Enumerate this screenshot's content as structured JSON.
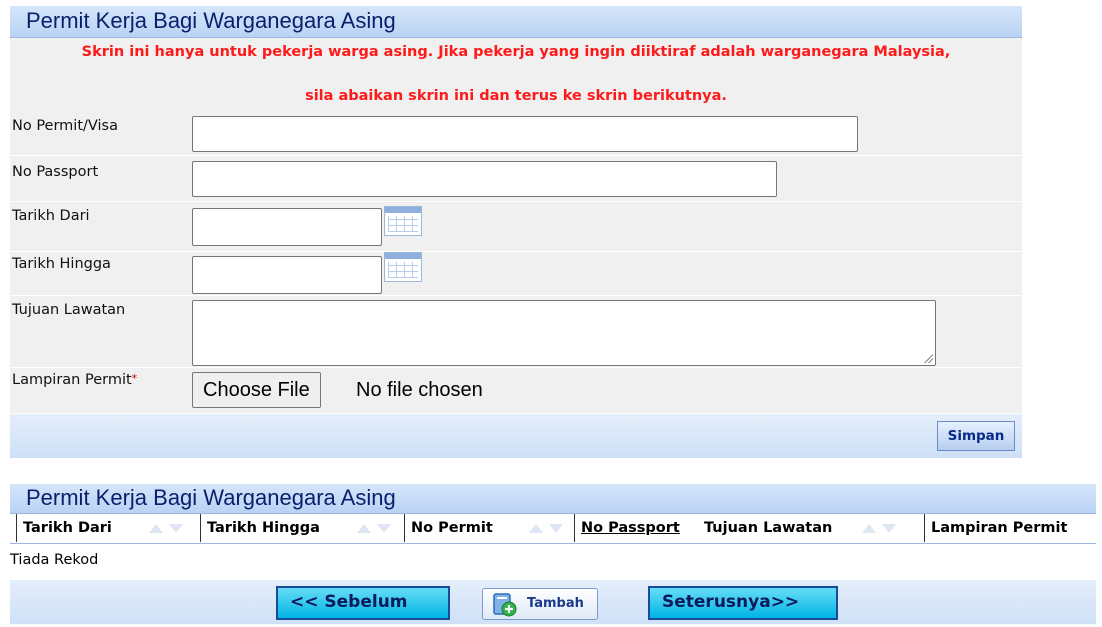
{
  "form": {
    "title": "Permit Kerja Bagi Warganegara Asing",
    "notice_line1": "Skrin ini hanya untuk pekerja warga asing. Jika pekerja yang ingin diiktiraf adalah warganegara Malaysia,",
    "notice_line2": "sila abaikan skrin ini dan terus ke skrin berikutnya.",
    "fields": {
      "permit_visa": {
        "label": "No Permit/Visa",
        "value": ""
      },
      "passport": {
        "label": "No Passport",
        "value": ""
      },
      "tarikh_dari": {
        "label": "Tarikh Dari",
        "value": ""
      },
      "tarikh_hingga": {
        "label": "Tarikh Hingga",
        "value": ""
      },
      "tujuan_lawatan": {
        "label": "Tujuan Lawatan",
        "value": ""
      },
      "lampiran_permit": {
        "label": "Lampiran Permit",
        "required_mark": "*",
        "button_label": "Choose File",
        "status": "No file chosen"
      }
    },
    "save_label": "Simpan"
  },
  "list": {
    "title": "Permit Kerja Bagi Warganegara Asing",
    "columns": [
      "Tarikh Dari",
      "Tarikh Hingga",
      "No Permit",
      "No Passport",
      "Tujuan Lawatan",
      "Lampiran Permit"
    ],
    "empty_text": "Tiada Rekod"
  },
  "nav": {
    "prev_label": "<< Sebelum",
    "add_label": "Tambah",
    "next_label": "Seterusnya>>"
  },
  "icons": {
    "calendar": "calendar-icon",
    "add": "add-document-icon",
    "sort": "sort-arrows-icon"
  },
  "colors": {
    "title_text": "#0a1f6b",
    "notice_text": "#ff1a1a",
    "nav_button": "#00b4e6"
  }
}
